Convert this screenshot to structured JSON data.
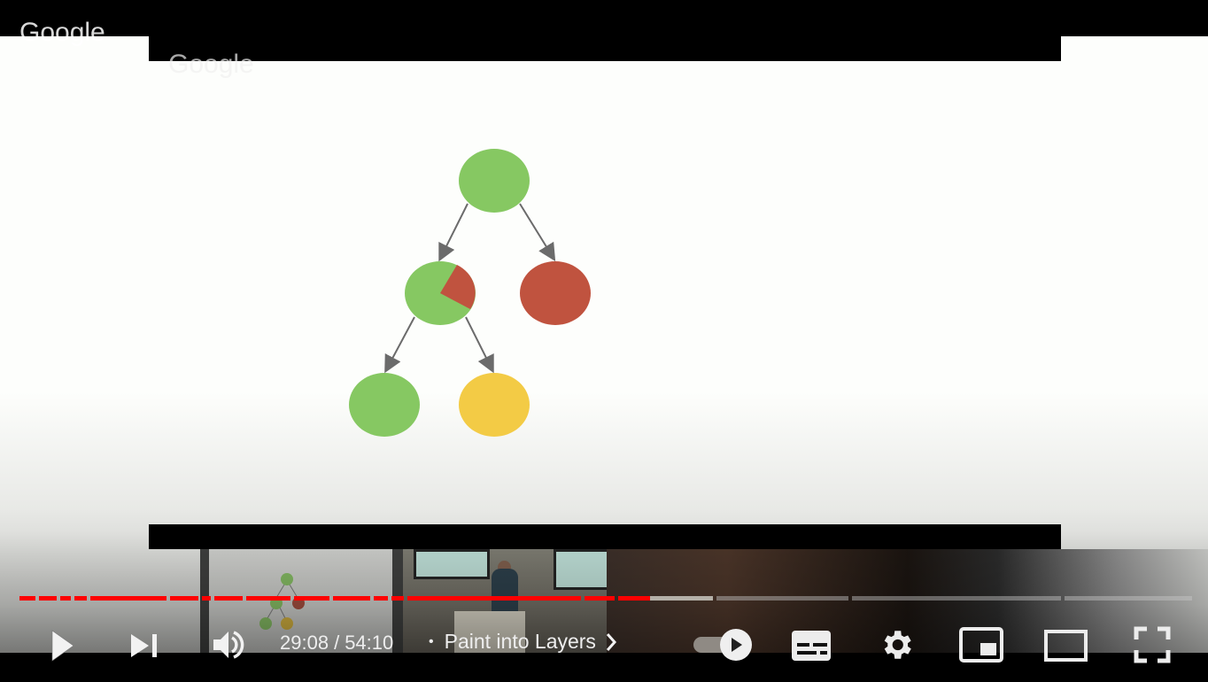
{
  "video": {
    "watermark_text": "Google",
    "slide": {
      "diagram_type": "tree",
      "nodes": [
        {
          "id": "root",
          "color": "#86c862",
          "state": "full-green"
        },
        {
          "id": "left-child",
          "color": "#86c862",
          "state": "green-with-red-slice",
          "slice_color": "#c0533f"
        },
        {
          "id": "right-child",
          "color": "#c0533f",
          "state": "full-red"
        },
        {
          "id": "left-left-grandchild",
          "color": "#86c862",
          "state": "full-green"
        },
        {
          "id": "left-right-grandchild",
          "color": "#f3cb45",
          "state": "full-yellow"
        }
      ],
      "edge_color": "#6b6b6b"
    }
  },
  "player": {
    "progress": {
      "played_fraction": 0.5378,
      "current_time": "29:08",
      "duration": "54:10",
      "accent_color": "#ff0000"
    },
    "time_separator": "/",
    "chapter_separator": "•",
    "chapter_title": "Paint into Layers",
    "controls": {
      "play": "play-icon",
      "next": "next-icon",
      "volume": "volume-icon",
      "autoplay": "autoplay-toggle",
      "subtitles": "subtitles-icon",
      "settings": "gear-icon",
      "miniplayer": "miniplayer-icon",
      "theater": "theater-mode-icon",
      "fullscreen": "fullscreen-icon"
    }
  }
}
